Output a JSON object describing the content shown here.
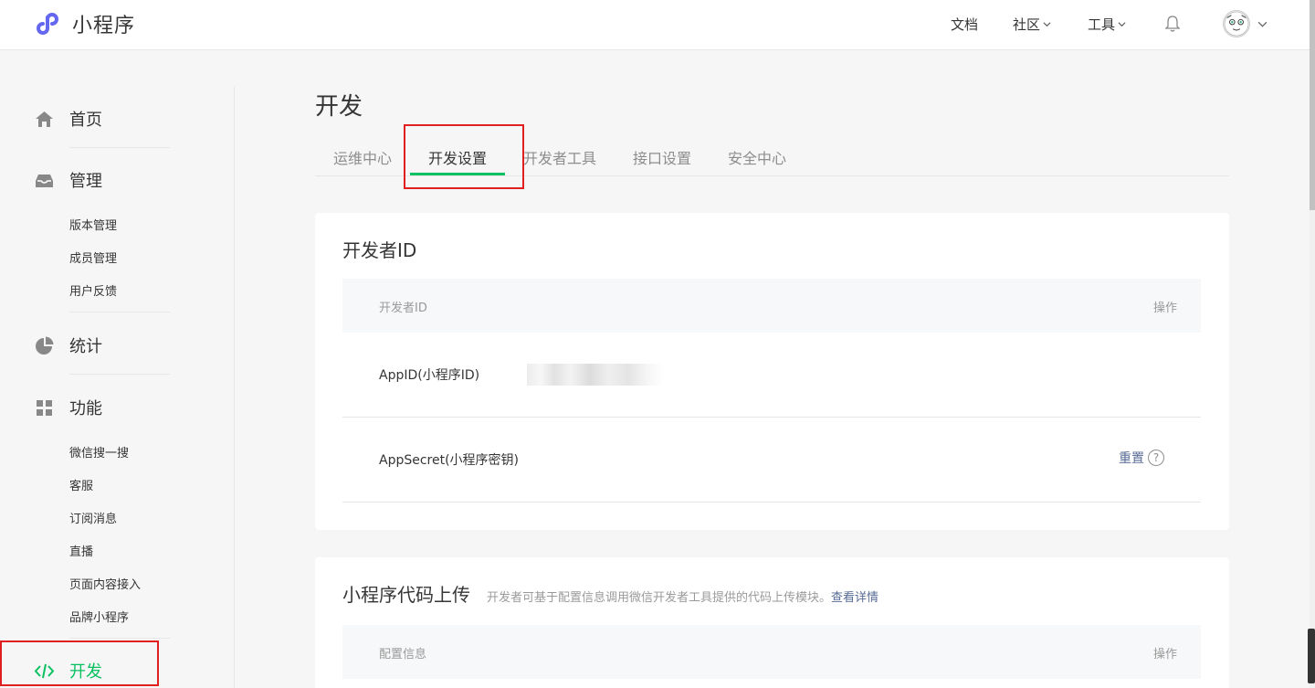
{
  "header": {
    "app_name": "小程序",
    "nav": [
      {
        "label": "文档"
      },
      {
        "label": "社区"
      },
      {
        "label": "工具"
      }
    ]
  },
  "sidebar": {
    "home": "首页",
    "manage": {
      "label": "管理",
      "items": [
        "版本管理",
        "成员管理",
        "用户反馈"
      ]
    },
    "stats": "统计",
    "features": {
      "label": "功能",
      "items": [
        "微信搜一搜",
        "客服",
        "订阅消息",
        "直播",
        "页面内容接入",
        "品牌小程序"
      ]
    },
    "dev": "开发"
  },
  "main": {
    "title": "开发",
    "tabs": [
      "运维中心",
      "开发设置",
      "开发者工具",
      "接口设置",
      "安全中心"
    ],
    "active_tab": "开发设置",
    "dev_id_card": {
      "title": "开发者ID",
      "col_name": "开发者ID",
      "col_action": "操作",
      "rows": [
        {
          "label": "AppID(小程序ID)"
        },
        {
          "label": "AppSecret(小程序密钥)",
          "action": "重置",
          "help": "?"
        }
      ]
    },
    "upload_card": {
      "title": "小程序代码上传",
      "desc": "开发者可基于配置信息调用微信开发者工具提供的代码上传模块。",
      "link": "查看详情",
      "col_name": "配置信息",
      "col_action": "操作"
    }
  },
  "colors": {
    "accent": "#07c160",
    "link": "#576b95",
    "highlight_box": "#e02020"
  }
}
